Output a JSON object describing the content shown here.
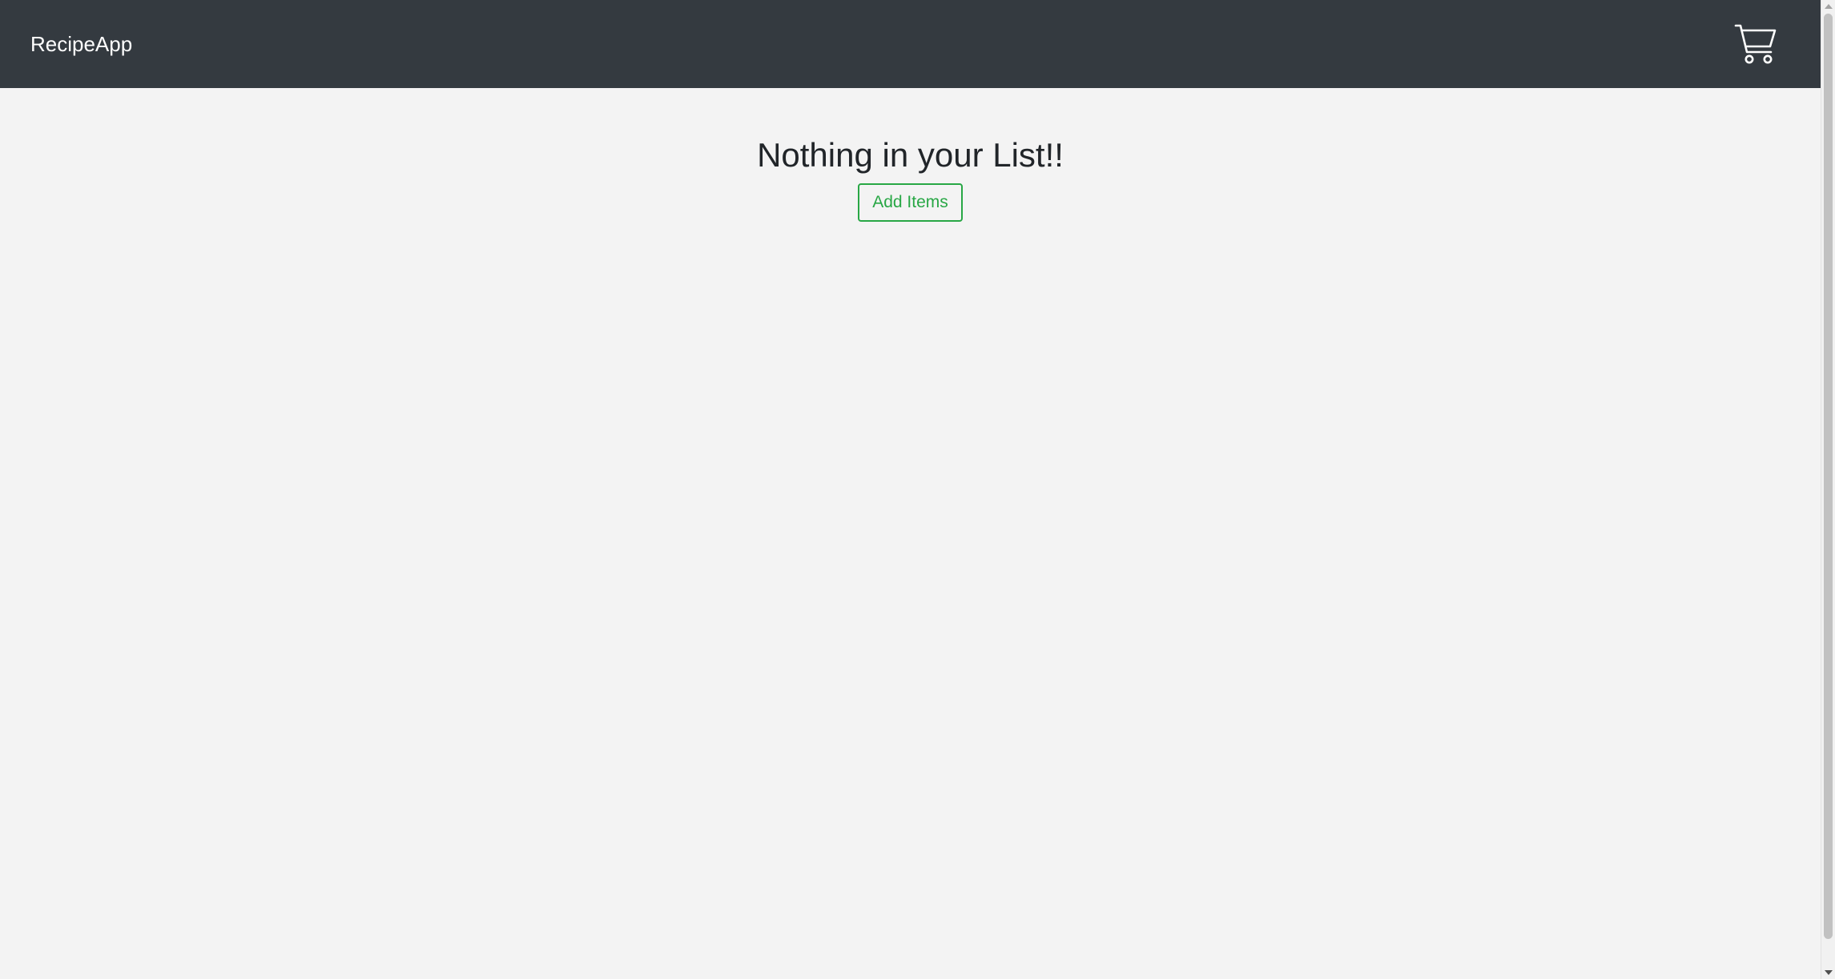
{
  "navbar": {
    "brand": "RecipeApp",
    "cart_icon": "shopping-cart-icon",
    "background": "#343a40"
  },
  "main": {
    "empty_message": "Nothing in your List!!",
    "add_button_label": "Add Items",
    "accent_color": "#28a745"
  }
}
